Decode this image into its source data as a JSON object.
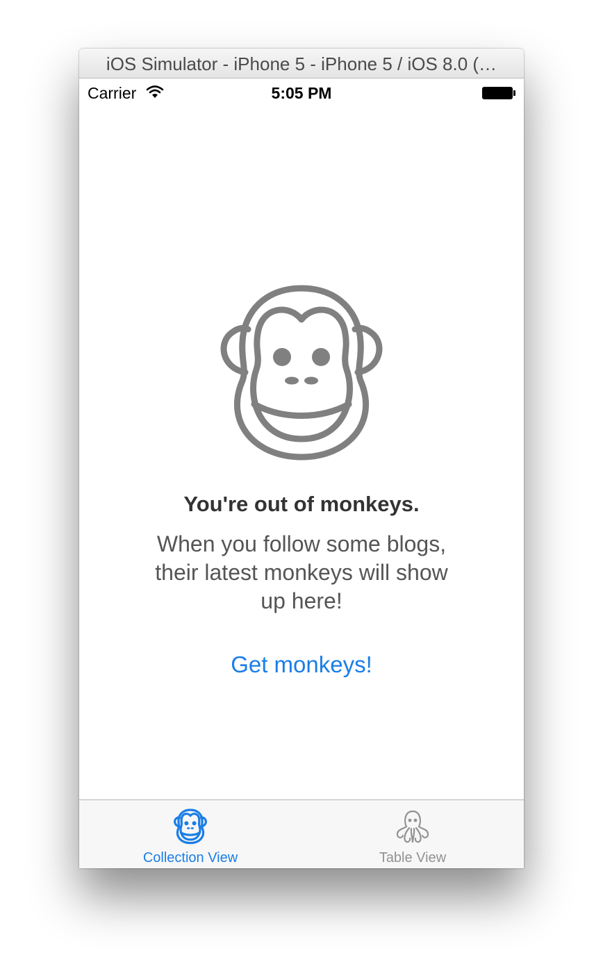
{
  "window": {
    "title": "iOS Simulator - iPhone 5 - iPhone 5 / iOS 8.0 (…"
  },
  "statusbar": {
    "carrier": "Carrier",
    "time": "5:05 PM"
  },
  "empty_state": {
    "icon": "monkey-icon",
    "title": "You're out of monkeys.",
    "message": "When you follow some blogs, their latest monkeys will show up here!",
    "action_label": "Get monkeys!"
  },
  "tabbar": {
    "tabs": [
      {
        "label": "Collection View",
        "icon": "monkey-icon",
        "selected": true
      },
      {
        "label": "Table View",
        "icon": "octopus-icon",
        "selected": false
      }
    ]
  },
  "colors": {
    "accent": "#1a7ee6",
    "icon_gray": "#808080",
    "tab_inactive": "#929292"
  }
}
